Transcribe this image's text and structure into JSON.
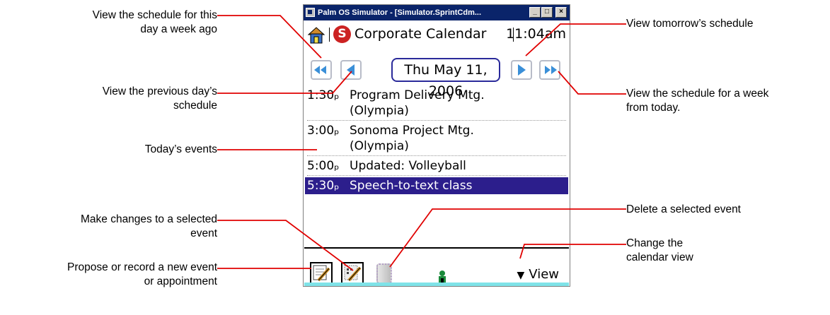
{
  "window": {
    "title": "Palm OS Simulator - [Simulator.SprintCdm...",
    "min_label": "_",
    "max_label": "□",
    "close_label": "×"
  },
  "app": {
    "name": "Corporate Calendar",
    "logo_letter": "S",
    "clock": "11:04am"
  },
  "date": "Thu May 11, 2006",
  "events": [
    {
      "time": "1:30ₚ",
      "title": "Program Delivery Mtg.",
      "location": "(Olympia)"
    },
    {
      "time": "3:00ₚ",
      "title": "Sonoma Project Mtg.",
      "location": "(Olympia)"
    },
    {
      "time": "5:00ₚ",
      "title": "Updated: Volleyball"
    },
    {
      "time": "5:30ₚ",
      "title": "Speech-to-text class",
      "selected": true
    }
  ],
  "view_menu": "View",
  "colors": {
    "titlebar": "#0a246a",
    "selection": "#2c1e8c",
    "leader_line": "#e00000",
    "nav_arrow": "#3a8fd8",
    "bottom_strip": "#7fe3e8"
  },
  "icons": [
    "home-icon",
    "s-logo-icon",
    "week-back-icon",
    "prev-day-icon",
    "next-day-icon",
    "week-forward-icon",
    "new-event-icon",
    "edit-event-icon",
    "trash-icon",
    "person-icon",
    "triangle-down-icon"
  ],
  "callouts": {
    "week_ago": [
      "View the schedule for this",
      "day a week ago"
    ],
    "prev_day": [
      "View the previous day’s",
      "schedule"
    ],
    "todays_events": [
      "Today’s events"
    ],
    "make_changes": [
      "Make changes to a selected",
      "event"
    ],
    "propose": [
      "Propose or record a new event",
      "or appointment"
    ],
    "tomorrow": [
      "View tomorrow’s schedule"
    ],
    "week_from_today": [
      "View the schedule for a week",
      "from today."
    ],
    "delete": [
      "Delete a selected event"
    ],
    "change_view": [
      "Change the",
      "calendar view"
    ]
  }
}
